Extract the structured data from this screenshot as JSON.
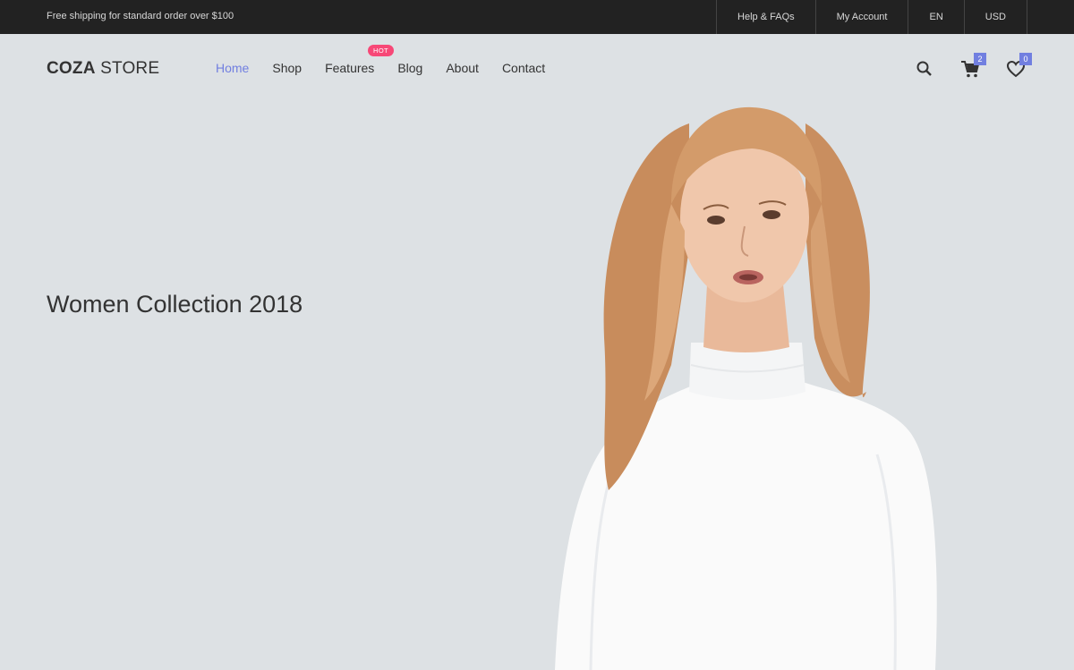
{
  "topbar": {
    "shipping_text": "Free shipping for standard order over $100",
    "links": [
      "Help & FAQs",
      "My Account",
      "EN",
      "USD"
    ]
  },
  "header": {
    "logo_bold": "COZA",
    "logo_rest": " STORE",
    "nav": [
      "Home",
      "Shop",
      "Features",
      "Blog",
      "About",
      "Contact"
    ],
    "active_nav": "Home",
    "hot_badge": "HOT",
    "cart_count": "2",
    "wishlist_count": "0"
  },
  "hero": {
    "headline": "Women Collection 2018"
  },
  "colors": {
    "accent": "#717fe0",
    "hot": "#f74877",
    "topbar_bg": "#222222",
    "hero_bg": "#dde1e4"
  },
  "icons": [
    "search-icon",
    "cart-icon",
    "heart-icon"
  ]
}
